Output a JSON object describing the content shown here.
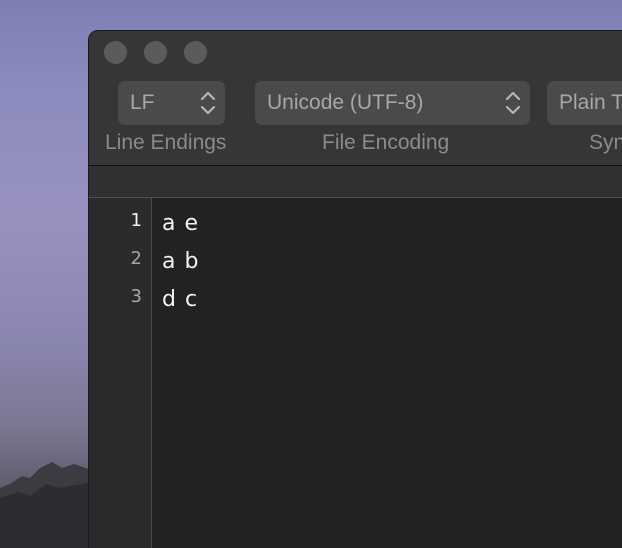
{
  "toolbar": {
    "line_endings": {
      "value": "LF",
      "label": "Line Endings"
    },
    "file_encoding": {
      "value": "Unicode (UTF-8)",
      "label": "File Encoding"
    },
    "syntax": {
      "value": "Plain Text",
      "label": "Syntax"
    }
  },
  "editor": {
    "line_numbers": [
      "1",
      "2",
      "3"
    ],
    "lines": [
      "a e",
      "a b",
      "d c"
    ],
    "active_line": 1
  },
  "colors": {
    "window_bg": "#2a2a2c",
    "titlebar_bg": "#363638",
    "popup_bg": "#4a4a4c",
    "editor_bg": "#222224",
    "gutter_bg": "#2b2b2d",
    "text": "#f2f2f2"
  },
  "icons": [
    "up-down-chevron-icon",
    "traffic-light-close",
    "traffic-light-minimize",
    "traffic-light-zoom"
  ]
}
